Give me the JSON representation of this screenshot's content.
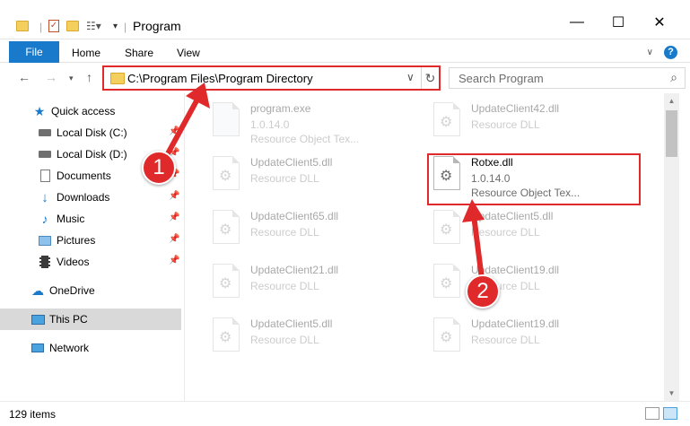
{
  "window": {
    "title": "Program",
    "minimize": "—",
    "maximize": "☐",
    "close": "✕"
  },
  "ribbon": {
    "file": "File",
    "tabs": [
      "Home",
      "Share",
      "View"
    ],
    "help": "?"
  },
  "address": {
    "path": "C:\\Program Files\\Program Directory",
    "search_placeholder": "Search Program"
  },
  "sidebar": {
    "items": [
      {
        "label": "Quick access",
        "icon": "star-icon"
      },
      {
        "label": "Local Disk (C:)",
        "icon": "drive-icon"
      },
      {
        "label": "Local Disk (D:)",
        "icon": "drive-icon"
      },
      {
        "label": "Documents",
        "icon": "documents-icon"
      },
      {
        "label": "Downloads",
        "icon": "downloads-icon"
      },
      {
        "label": "Music",
        "icon": "music-icon"
      },
      {
        "label": "Pictures",
        "icon": "pictures-icon"
      },
      {
        "label": "Videos",
        "icon": "videos-icon"
      },
      {
        "label": "OneDrive",
        "icon": "cloud-icon"
      },
      {
        "label": "This PC",
        "icon": "computer-icon"
      },
      {
        "label": "Network",
        "icon": "network-icon"
      }
    ]
  },
  "files": [
    {
      "name": "program.exe",
      "line2": "1.0.14.0",
      "line3": "Resource Object Tex..."
    },
    {
      "name": "UpdateClient42.dll",
      "line2": "Resource DLL",
      "line3": ""
    },
    {
      "name": "UpdateClient5.dll",
      "line2": "Resource DLL",
      "line3": ""
    },
    {
      "name": "Rotxe.dll",
      "line2": "1.0.14.0",
      "line3": "Resource Object Tex..."
    },
    {
      "name": "UpdateClient65.dll",
      "line2": "Resource DLL",
      "line3": ""
    },
    {
      "name": "UpdateClient5.dll",
      "line2": "Resource DLL",
      "line3": ""
    },
    {
      "name": "UpdateClient21.dll",
      "line2": "Resource DLL",
      "line3": ""
    },
    {
      "name": "UpdateClient19.dll",
      "line2": "Resource DLL",
      "line3": ""
    },
    {
      "name": "UpdateClient5.dll",
      "line2": "Resource DLL",
      "line3": ""
    },
    {
      "name": "UpdateClient19.dll",
      "line2": "Resource DLL",
      "line3": ""
    }
  ],
  "status": {
    "item_count": "129 items"
  },
  "annotations": {
    "step1": "1",
    "step2": "2",
    "color": "#e0292b"
  }
}
